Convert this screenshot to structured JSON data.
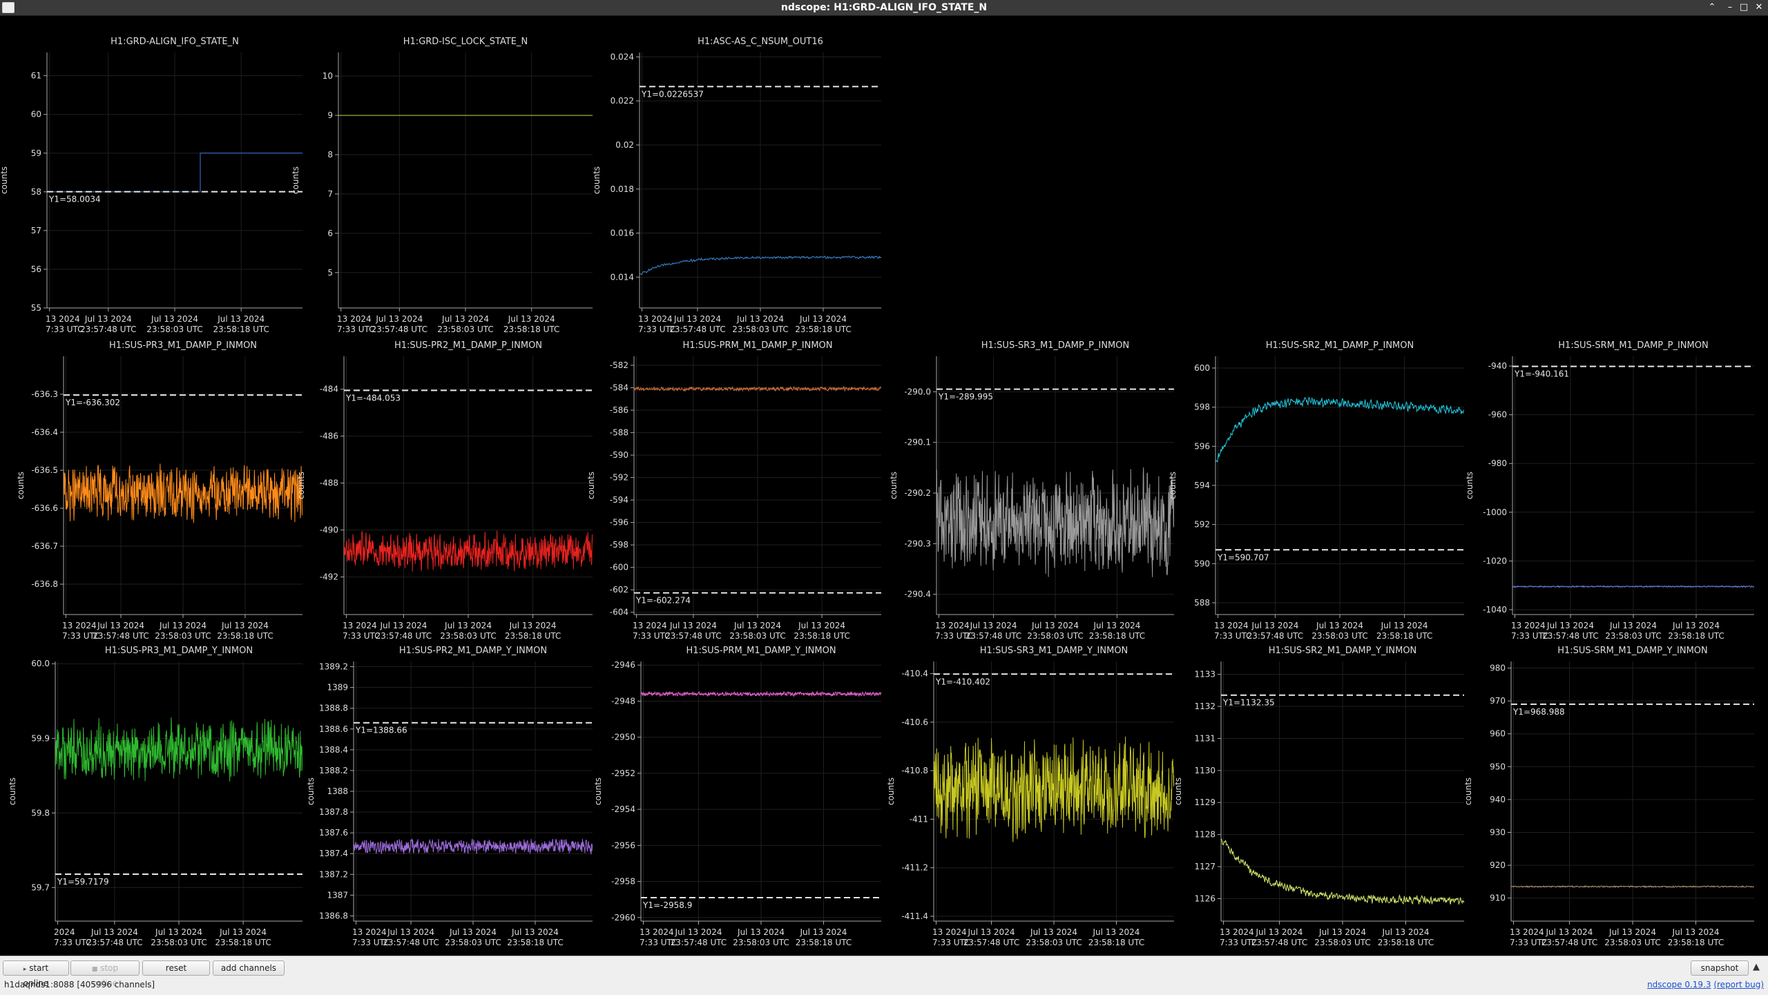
{
  "window": {
    "title": "ndscope: H1:GRD-ALIGN_IFO_STATE_N"
  },
  "toolbar": {
    "start_online": "start online",
    "stop_online": "stop online",
    "reset": "reset",
    "add_channels": "add channels",
    "snapshot": "snapshot"
  },
  "status": {
    "server": "h1daqnds1:8088",
    "channels": "[405996 channels]",
    "app_name": "ndscope",
    "version": "0.19.3",
    "report_bug": "(report bug)"
  },
  "time_axis": {
    "tick_line1": [
      "13 2024",
      "Jul 13 2024",
      "Jul 13 2024",
      "Jul 13 2024"
    ],
    "tick_line2": [
      "7:33 UTC",
      "23:57:48 UTC",
      "23:58:03 UTC",
      "23:58:18 UTC"
    ]
  },
  "chart_data": [
    {
      "type": "line",
      "title": "H1:GRD-ALIGN_IFO_STATE_N",
      "ylabel": "counts",
      "ylim": [
        55,
        61.6
      ],
      "yticks": [
        55,
        56,
        57,
        58,
        59,
        60,
        61
      ],
      "ytick_labels": [
        "55",
        "56",
        "57",
        "58",
        "59",
        "60",
        "61"
      ],
      "series": [
        {
          "name": "H1:GRD-ALIGN_IFO_STATE_N",
          "color": "#3d7be0",
          "style": "step",
          "step_at": 0.6,
          "before": 58,
          "after": 59
        }
      ],
      "cursor": {
        "value": 58.0034,
        "label": "Y1=58.0034"
      },
      "xtick_prefix": "13 2024"
    },
    {
      "type": "line",
      "title": "H1:GRD-ISC_LOCK_STATE_N",
      "ylabel": "counts",
      "ylim": [
        4.1,
        10.6
      ],
      "yticks": [
        5,
        6,
        7,
        8,
        9,
        10
      ],
      "ytick_labels": [
        "5",
        "6",
        "7",
        "8",
        "9",
        "10"
      ],
      "series": [
        {
          "name": "H1:GRD-ISC_LOCK_STATE_N",
          "color": "#b8d93a",
          "style": "flat",
          "value": 9
        }
      ],
      "xtick_prefix": "13 2024"
    },
    {
      "type": "line",
      "title": "H1:ASC-AS_C_NSUM_OUT16",
      "ylabel": "counts",
      "ylim": [
        0.0126,
        0.0242
      ],
      "yticks": [
        0.014,
        0.016,
        0.018,
        0.02,
        0.022,
        0.024
      ],
      "ytick_labels": [
        "0.014",
        "0.016",
        "0.018",
        "0.02",
        "0.022",
        "0.024"
      ],
      "series": [
        {
          "name": "H1:ASC-AS_C_NSUM_OUT16",
          "color": "#3d86d9",
          "style": "rise",
          "start": 0.0141,
          "end": 0.0149,
          "noise": 4e-05
        }
      ],
      "cursor": {
        "value": 0.0226537,
        "label": "Y1=0.0226537"
      },
      "xtick_prefix": "13 2024"
    },
    {
      "type": "line",
      "title": "H1:SUS-PR3_M1_DAMP_P_INMON",
      "ylabel": "counts",
      "ylim": [
        -636.88,
        -636.2
      ],
      "yticks": [
        -636.8,
        -636.7,
        -636.6,
        -636.5,
        -636.4,
        -636.3
      ],
      "ytick_labels": [
        "-636.8",
        "-636.7",
        "-636.6",
        "-636.5",
        "-636.4",
        "-636.3"
      ],
      "series": [
        {
          "name": "H1:SUS-PR3_M1_DAMP_P_INMON",
          "color": "#ff8c1a",
          "style": "noise",
          "center": -636.56,
          "amp": 0.05
        }
      ],
      "cursor": {
        "value": -636.302,
        "label": "Y1=-636.302"
      },
      "xtick_prefix": ""
    },
    {
      "type": "line",
      "title": "H1:SUS-PR2_M1_DAMP_P_INMON",
      "ylabel": "counts",
      "ylim": [
        -493.6,
        -482.6
      ],
      "yticks": [
        -492,
        -490,
        -488,
        -486,
        -484
      ],
      "ytick_labels": [
        "-492",
        "-490",
        "-488",
        "-486",
        "-484"
      ],
      "series": [
        {
          "name": "H1:SUS-PR2_M1_DAMP_P_INMON",
          "color": "#e8231f",
          "style": "noise",
          "center": -490.9,
          "amp": 0.55
        }
      ],
      "cursor": {
        "value": -484.053,
        "label": "Y1=-484.053"
      },
      "xtick_prefix": "13 2024"
    },
    {
      "type": "line",
      "title": "H1:SUS-PRM_M1_DAMP_P_INMON",
      "ylabel": "counts",
      "ylim": [
        -604.2,
        -581.2
      ],
      "yticks": [
        -604,
        -602,
        -600,
        -598,
        -596,
        -594,
        -592,
        -590,
        -588,
        -586,
        -584,
        -582
      ],
      "ytick_labels": [
        "-604",
        "-602",
        "-600",
        "-598",
        "-596",
        "-594",
        "-592",
        "-590",
        "-588",
        "-586",
        "-584",
        "-582"
      ],
      "series": [
        {
          "name": "H1:SUS-PRM_M1_DAMP_P_INMON",
          "color": "#c46a3c",
          "style": "noise",
          "center": -584.1,
          "amp": 0.12
        }
      ],
      "cursor": {
        "value": -602.274,
        "label": "Y1=-602.274"
      },
      "xtick_prefix": "13 2024"
    },
    {
      "type": "line",
      "title": "H1:SUS-SR3_M1_DAMP_P_INMON",
      "ylabel": "counts",
      "ylim": [
        -290.44,
        -289.93
      ],
      "yticks": [
        -290.4,
        -290.3,
        -290.2,
        -290.1,
        -290.0
      ],
      "ytick_labels": [
        "-290.4",
        "-290.3",
        "-290.2",
        "-290.1",
        "-290.0"
      ],
      "series": [
        {
          "name": "H1:SUS-SR3_M1_DAMP_P_INMON",
          "color": "#9a9a9a",
          "style": "noise",
          "center": -290.26,
          "amp": 0.07
        }
      ],
      "cursor": {
        "value": -289.995,
        "label": "Y1=-289.995"
      },
      "xtick_prefix": "13 2024"
    },
    {
      "type": "line",
      "title": "H1:SUS-SR2_M1_DAMP_P_INMON",
      "ylabel": "counts",
      "ylim": [
        587.4,
        600.6
      ],
      "yticks": [
        588,
        590,
        592,
        594,
        596,
        598,
        600
      ],
      "ytick_labels": [
        "588",
        "590",
        "592",
        "594",
        "596",
        "598",
        "600"
      ],
      "series": [
        {
          "name": "H1:SUS-SR2_M1_DAMP_P_INMON",
          "color": "#22c9e0",
          "style": "riseflat",
          "start": 595.0,
          "peak": 598.5,
          "end": 597.8,
          "noise": 0.18
        }
      ],
      "cursor": {
        "value": 590.707,
        "label": "Y1=590.707"
      },
      "xtick_prefix": "13 2024"
    },
    {
      "type": "line",
      "title": "H1:SUS-SRM_M1_DAMP_P_INMON",
      "ylabel": "counts",
      "ylim": [
        -1042,
        -936
      ],
      "yticks": [
        -1040,
        -1020,
        -1000,
        -980,
        -960,
        -940
      ],
      "ytick_labels": [
        "-1040",
        "-1020",
        "-1000",
        "-980",
        "-960",
        "-940"
      ],
      "series": [
        {
          "name": "H1:SUS-SRM_M1_DAMP_P_INMON",
          "color": "#6a7ed8",
          "style": "noise",
          "center": -1030.5,
          "amp": 0.2
        }
      ],
      "cursor": {
        "value": -940.161,
        "label": "Y1=-940.161"
      },
      "xtick_prefix": "13 2024"
    },
    {
      "type": "line",
      "title": "H1:SUS-PR3_M1_DAMP_Y_INMON",
      "ylabel": "counts",
      "ylim": [
        59.655,
        60.003
      ],
      "yticks": [
        59.7,
        59.8,
        59.9,
        60.0
      ],
      "ytick_labels": [
        "59.7",
        "59.8",
        "59.9",
        "60.0"
      ],
      "series": [
        {
          "name": "H1:SUS-PR3_M1_DAMP_Y_INMON",
          "color": "#2fb82f",
          "style": "noise",
          "center": 59.885,
          "amp": 0.028
        }
      ],
      "cursor": {
        "value": 59.7179,
        "label": "Y1=59.7179"
      },
      "xtick_prefix": "2024"
    },
    {
      "type": "line",
      "title": "H1:SUS-PR2_M1_DAMP_Y_INMON",
      "ylabel": "counts",
      "ylim": [
        1386.75,
        1389.25
      ],
      "yticks": [
        1386.8,
        1387,
        1387.2,
        1387.4,
        1387.6,
        1387.8,
        1388,
        1388.2,
        1388.4,
        1388.6,
        1388.8,
        1389,
        1389.2
      ],
      "ytick_labels": [
        "1386.8",
        "1387",
        "1387.2",
        "1387.4",
        "1387.6",
        "1387.8",
        "1388",
        "1388.2",
        "1388.4",
        "1388.6",
        "1388.8",
        "1389",
        "1389.2"
      ],
      "series": [
        {
          "name": "H1:SUS-PR2_M1_DAMP_Y_INMON",
          "color": "#9a6ad8",
          "style": "noise",
          "center": 1387.47,
          "amp": 0.05
        }
      ],
      "cursor": {
        "value": 1388.66,
        "label": "Y1=1388.66"
      },
      "xtick_prefix": "13 2024"
    },
    {
      "type": "line",
      "title": "H1:SUS-PRM_M1_DAMP_Y_INMON",
      "ylabel": "counts",
      "ylim": [
        -2960.2,
        -2945.8
      ],
      "yticks": [
        -2960,
        -2958,
        -2956,
        -2954,
        -2952,
        -2950,
        -2948,
        -2946
      ],
      "ytick_labels": [
        "-2960",
        "-2958",
        "-2956",
        "-2954",
        "-2952",
        "-2950",
        "-2948",
        "-2946"
      ],
      "series": [
        {
          "name": "H1:SUS-PRM_M1_DAMP_Y_INMON",
          "color": "#e060c8",
          "style": "noise",
          "center": -2947.6,
          "amp": 0.08
        }
      ],
      "cursor": {
        "value": -2958.9,
        "label": "Y1=-2958.9"
      },
      "xtick_prefix": "13 2024"
    },
    {
      "type": "line",
      "title": "H1:SUS-SR3_M1_DAMP_Y_INMON",
      "ylabel": "counts",
      "ylim": [
        -411.42,
        -410.35
      ],
      "yticks": [
        -411.4,
        -411.2,
        -411,
        -410.8,
        -410.6,
        -410.4
      ],
      "ytick_labels": [
        "-411.4",
        "-411.2",
        "-411",
        "-410.8",
        "-410.6",
        "-410.4"
      ],
      "series": [
        {
          "name": "H1:SUS-SR3_M1_DAMP_Y_INMON",
          "color": "#c8c823",
          "style": "noise",
          "center": -410.88,
          "amp": 0.14
        }
      ],
      "cursor": {
        "value": -410.402,
        "label": "Y1=-410.402"
      },
      "xtick_prefix": "13 2024"
    },
    {
      "type": "line",
      "title": "H1:SUS-SR2_M1_DAMP_Y_INMON",
      "ylabel": "counts",
      "ylim": [
        1125.3,
        1133.4
      ],
      "yticks": [
        1126,
        1127,
        1128,
        1129,
        1130,
        1131,
        1132,
        1133
      ],
      "ytick_labels": [
        "1126",
        "1127",
        "1128",
        "1129",
        "1130",
        "1131",
        "1132",
        "1133"
      ],
      "series": [
        {
          "name": "H1:SUS-SR2_M1_DAMP_Y_INMON",
          "color": "#d6e86a",
          "style": "decay",
          "start": 1127.9,
          "end": 1125.95,
          "noise": 0.1
        }
      ],
      "cursor": {
        "value": 1132.35,
        "label": "Y1=1132.35"
      },
      "xtick_prefix": "13 2024"
    },
    {
      "type": "line",
      "title": "H1:SUS-SRM_M1_DAMP_Y_INMON",
      "ylabel": "counts",
      "ylim": [
        903,
        982
      ],
      "yticks": [
        910,
        920,
        930,
        940,
        950,
        960,
        970,
        980
      ],
      "ytick_labels": [
        "910",
        "920",
        "930",
        "940",
        "950",
        "960",
        "970",
        "980"
      ],
      "series": [
        {
          "name": "H1:SUS-SRM_M1_DAMP_Y_INMON",
          "color": "#a88a6a",
          "style": "noise",
          "center": 913.5,
          "amp": 0.15
        }
      ],
      "cursor": {
        "value": 968.988,
        "label": "Y1=968.988"
      },
      "xtick_prefix": "13 2024"
    }
  ]
}
